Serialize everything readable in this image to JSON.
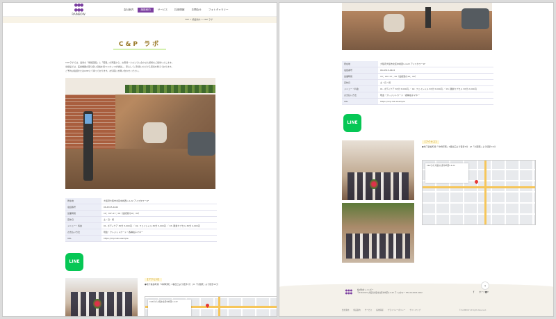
{
  "header": {
    "logo_text": "RAINBOW",
    "nav": [
      "会社案内",
      "施設案内",
      "サービス",
      "採用情報",
      "お問合せ",
      "フォトギャラリー"
    ],
    "breadcrumb": "TOP > 施設案内 > C&P ラボ"
  },
  "page": {
    "title": "C&P ラボ",
    "intro": [
      "C&Pラボでは、最新の「機能回復」と「美容」の両面から、お客様一人ひとりに合わせた施術をご提供いたします。",
      "当施設では、医療機器の取り扱い資格を持つスタッフが常駐し、安心してご利用いただける環境を整えております。",
      "ご予約は電話またはLINEにて承っております。お気軽にお問い合わせください。"
    ]
  },
  "info_table": [
    {
      "key": "所在地",
      "value": "大阪府大阪市北区中崎西1-4-22 アイスタワー1F"
    },
    {
      "key": "電話番号",
      "value": "06-6315-4422"
    },
    {
      "key": "営業時間",
      "value": "10：00～17：00（最終受付16：00）"
    },
    {
      "key": "定休日",
      "value": "土・日・祝"
    },
    {
      "key": "メニュー・料金",
      "value": "01. ボディケア 30分 3,000円 ／ 02. フェイシャル 30分 3,000円 ／ 03. 酸素カプセル 30分 2,000円"
    },
    {
      "key": "お支払い方法",
      "value": "現金・クレジットカード・各種電子マネー"
    },
    {
      "key": "URL",
      "value": "https://cnp-lab.example"
    }
  ],
  "line_label": "LINE",
  "access": {
    "label": "【アクセス】",
    "text": "●地下鉄谷町線「中崎町駅」2番出口より徒歩3分　JR「大阪駅」より徒歩12分",
    "map_card": "C&Pラボ\n大阪市北区中崎西1-4-22"
  },
  "footer": {
    "company": "株式会社レインボー",
    "address": "〒530-0015 大阪府大阪市北区中崎西1-4-22 アイスタワー TEL 06-6315-4422",
    "links": [
      "会社案内",
      "施設案内",
      "サービス",
      "採用情報",
      "プライバシーポリシー",
      "サイトマップ"
    ],
    "copyright": "© RAINBOW All Rights Reserved.",
    "to_top": "↑",
    "to_top_label": "ページTOP"
  }
}
